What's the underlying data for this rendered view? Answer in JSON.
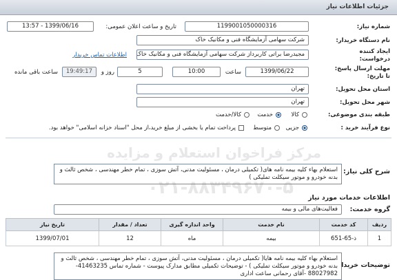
{
  "header": {
    "title": "جزئیات اطلاعات نیاز"
  },
  "need_number": {
    "label": "شماره نیاز:",
    "value": "1199001050000316"
  },
  "announce": {
    "label": "تاریخ و ساعت اعلان عمومی:",
    "value": "1399/06/16 - 13:57"
  },
  "buyer_org": {
    "label": "نام دستگاه خریدار:",
    "value": "شرکت سهامی آزمایشگاه فنی و مکانیک خاک"
  },
  "creator": {
    "label1": "ایجاد کننده",
    "label2": "درخواست:",
    "value": "مجیدرضا براتی کاربرداز  شرکت سهامی آزمایشگاه فنی و مکانیک خاک",
    "contact_link": "اطلاعات تماس خریدار"
  },
  "deadline": {
    "label1": "مهلت ارسال پاسخ:",
    "label2": "تا تاریخ:",
    "date": "1399/06/22",
    "time_label": "ساعت",
    "time": "10:00",
    "days": "5",
    "day_label": "روز و",
    "remaining": "19:49:17",
    "remaining_label": "ساعت باقی مانده"
  },
  "province": {
    "label": "استان محل تحویل:",
    "value": "تهران"
  },
  "city": {
    "label": "شهر محل تحویل:",
    "value": "تهران"
  },
  "category": {
    "label": "طبقه بندی موضوعی:",
    "options": [
      "کالا",
      "خدمت",
      "کالا/خدمت"
    ],
    "selected": "خدمت"
  },
  "process": {
    "label": "نوع فرآیند خرید :",
    "options": [
      "جزیی",
      "متوسط"
    ],
    "selected": "جزیی",
    "payment_note": "پرداخت تمام یا بخشی از مبلغ خرید،از محل \"اسناد خزانه اسلامی\" خواهد بود."
  },
  "summary": {
    "label": "شرح کلی نیاز:",
    "text": "استعلام بهاء کلیه بیمه نامه های( تکمیلی درمان ، مسئولیت مدنی، آتش سوزی ، تمام خطر مهندسی ، شخص ثالث و بدنه  خودرو و موتور سیکلت تملیکی )"
  },
  "services_section": {
    "title": "اطلاعات خدمات مورد نیاز"
  },
  "service_group": {
    "label": "گروه خدمت:",
    "value": "فعالیت‌های مالی و بیمه"
  },
  "table": {
    "headers": [
      "ردیف",
      "کد خدمت",
      "نام خدمت",
      "واحد اندازه گیری",
      "تعداد / مقدار",
      "تاریخ نیاز"
    ],
    "rows": [
      [
        "1",
        "ذ-65-651",
        "بیمه",
        "ماه",
        "12",
        "1399/07/01"
      ]
    ]
  },
  "buyer_notes": {
    "label": "توضیحات خریدار:",
    "text": "استعلام بهاء کلیه بیمه نامه هایا( تکمیلی درمان ، مسئولیت مدنی، آتش سوزی ، تمام خطر مهندسی ، شخص ثالث و بدنه  خودرو و موتور سیکلت تملیکی )  -  توضیحات تکمیلی مطابق مدارک پیوست - شماره تماس 41463235-88027982 -آقای رحمانی ساعت  اداری"
  },
  "watermark": {
    "line1": "مرکز فراخوان استعلام و مزایده",
    "line2": "۰۲۱-۸۸۳۴۹۶۷۰-۵"
  }
}
